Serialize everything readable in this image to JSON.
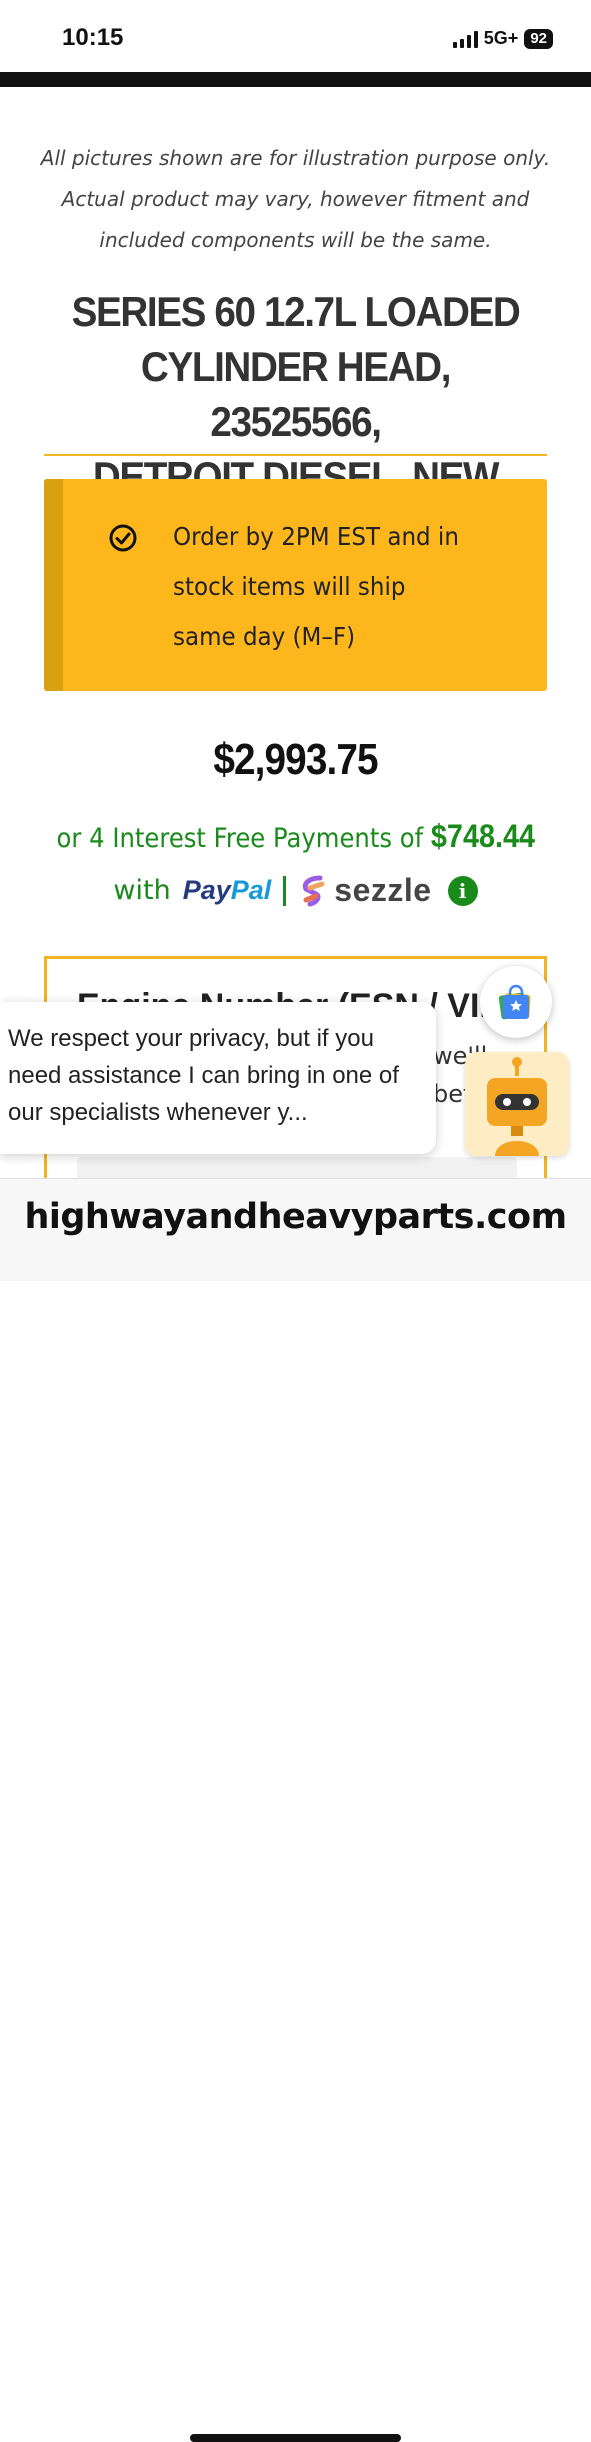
{
  "status": {
    "time": "10:15",
    "network": "5G+",
    "battery": "92"
  },
  "product": {
    "disclaimer_lines": [
      "All pictures shown are for illustration purpose only.",
      "Actual product may vary, however fitment and",
      "included components will be the same."
    ],
    "title_lines": [
      "SERIES 60 12.7L LOADED",
      "CYLINDER HEAD, 23525566,",
      "DETROIT DIESEL, NEW"
    ],
    "shipping_lines": [
      "Order by 2PM EST and in",
      "stock items will ship",
      "same day (M–F)"
    ],
    "price": "$2,993.75",
    "installment_text": "or 4 Interest Free Payments of",
    "installment_amount": "$748.44",
    "with_label": "with",
    "paypal_pay": "Pay",
    "paypal_pal": "Pal",
    "sezzle_label": "sezzle"
  },
  "engine_section": {
    "title": "Engine Number (ESN / VIN)",
    "sub_lines": [
      "we'll",
      "bet"
    ]
  },
  "privacy_popup": {
    "text": "We respect your privacy, but if you need assistance I can bring in one of our specialists whenever y..."
  },
  "browser": {
    "url": "highwayandheavyparts.com"
  },
  "colors": {
    "accent_yellow": "#fdb71c",
    "accent_dark_yellow": "#d9a012",
    "green": "#1a8a1a",
    "paypal_dark": "#253b80",
    "paypal_light": "#179bd7"
  },
  "icons": [
    "checkmark-circle-icon",
    "info-icon",
    "sezzle-logo-icon",
    "shop-bag-icon",
    "chatbot-icon"
  ]
}
